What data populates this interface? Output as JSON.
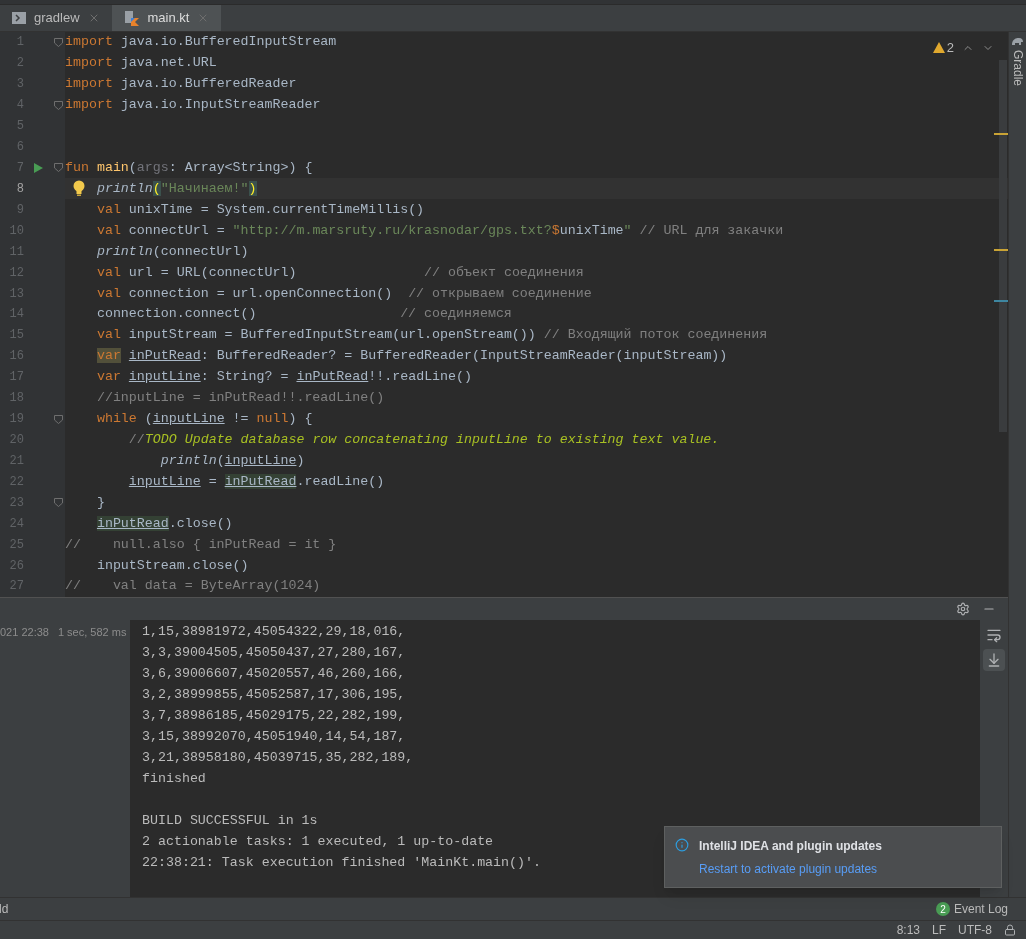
{
  "tabs": [
    {
      "label": "gradlew",
      "kind": "terminal",
      "selected": false
    },
    {
      "label": "main.kt",
      "kind": "kotlin",
      "selected": true
    }
  ],
  "editor": {
    "warnings": "2",
    "lines": [
      {
        "number": "1",
        "fold": true,
        "current": false,
        "runnable": false,
        "hint": false,
        "tokens": [
          {
            "text": "import",
            "kind": "kw"
          },
          {
            "text": " java.io.BufferedInputStream",
            "kind": "plain"
          }
        ]
      },
      {
        "number": "2",
        "fold": false,
        "current": false,
        "runnable": false,
        "hint": false,
        "tokens": [
          {
            "text": "import",
            "kind": "kw"
          },
          {
            "text": " java.net.URL",
            "kind": "plain"
          }
        ]
      },
      {
        "number": "3",
        "fold": false,
        "current": false,
        "runnable": false,
        "hint": false,
        "tokens": [
          {
            "text": "import",
            "kind": "kw"
          },
          {
            "text": " java.io.BufferedReader",
            "kind": "plain"
          }
        ]
      },
      {
        "number": "4",
        "fold": true,
        "current": false,
        "runnable": false,
        "hint": false,
        "tokens": [
          {
            "text": "import",
            "kind": "kw"
          },
          {
            "text": " java.io.InputStreamReader",
            "kind": "plain"
          }
        ]
      },
      {
        "number": "5",
        "fold": false,
        "current": false,
        "runnable": false,
        "hint": false
      },
      {
        "number": "6",
        "fold": false,
        "current": false,
        "runnable": false,
        "hint": false
      },
      {
        "number": "7",
        "fold": true,
        "current": false,
        "runnable": true,
        "hint": false,
        "tokens": [
          {
            "text": "fun ",
            "kind": "kw"
          },
          {
            "text": "main",
            "kind": "fn"
          },
          {
            "text": "(",
            "kind": "plain"
          },
          {
            "text": "args",
            "kind": "param"
          },
          {
            "text": ": Array<String>) {",
            "kind": "plain"
          }
        ]
      },
      {
        "number": "8",
        "fold": false,
        "current": true,
        "runnable": false,
        "hint": true,
        "tokens": [
          {
            "text": "    println",
            "kind": "call"
          },
          {
            "text": "(",
            "kind": "brace"
          },
          {
            "text": "\"Начинаем!\"",
            "kind": "str"
          },
          {
            "text": ")",
            "kind": "brace"
          }
        ]
      },
      {
        "number": "9",
        "fold": false,
        "current": false,
        "runnable": false,
        "hint": false,
        "tokens": [
          {
            "text": "    val",
            "kind": "kw"
          },
          {
            "text": " unixTime = System.currentTimeMillis()",
            "kind": "plain"
          }
        ]
      },
      {
        "number": "10",
        "fold": false,
        "current": false,
        "runnable": false,
        "hint": false,
        "tokens": [
          {
            "text": "    val",
            "kind": "kw"
          },
          {
            "text": " connectUrl = ",
            "kind": "plain"
          },
          {
            "text": "\"http://m.marsruty.ru/krasnodar/gps.txt?",
            "kind": "str"
          },
          {
            "text": "$",
            "kind": "kw"
          },
          {
            "text": "unixTime",
            "kind": "plain"
          },
          {
            "text": "\"",
            "kind": "str"
          },
          {
            "text": " // URL для закачки",
            "kind": "cmt"
          }
        ]
      },
      {
        "number": "11",
        "fold": false,
        "current": false,
        "runnable": false,
        "hint": false,
        "tokens": [
          {
            "text": "    println",
            "kind": "call"
          },
          {
            "text": "(connectUrl)",
            "kind": "plain"
          }
        ]
      },
      {
        "number": "12",
        "fold": false,
        "current": false,
        "runnable": false,
        "hint": false,
        "tokens": [
          {
            "text": "    val",
            "kind": "kw"
          },
          {
            "text": " url = URL(connectUrl)                ",
            "kind": "plain"
          },
          {
            "text": "// объект соединения",
            "kind": "cmt"
          }
        ]
      },
      {
        "number": "13",
        "fold": false,
        "current": false,
        "runnable": false,
        "hint": false,
        "tokens": [
          {
            "text": "    val",
            "kind": "kw"
          },
          {
            "text": " connection = url.openConnection()  ",
            "kind": "plain"
          },
          {
            "text": "// открываем соединение",
            "kind": "cmt"
          }
        ]
      },
      {
        "number": "14",
        "fold": false,
        "current": false,
        "runnable": false,
        "hint": false,
        "tokens": [
          {
            "text": "    connection.connect()                  ",
            "kind": "plain"
          },
          {
            "text": "// соединяемся",
            "kind": "cmt"
          }
        ]
      },
      {
        "number": "15",
        "fold": false,
        "current": false,
        "runnable": false,
        "hint": false,
        "tokens": [
          {
            "text": "    val",
            "kind": "kw"
          },
          {
            "text": " inputStream = BufferedInputStream(url.openStream()) ",
            "kind": "plain"
          },
          {
            "text": "// Входящий поток соединения",
            "kind": "cmt"
          }
        ]
      },
      {
        "number": "16",
        "fold": false,
        "current": false,
        "runnable": false,
        "hint": false,
        "tokens": [
          {
            "text": "    var",
            "kind": "kw-hl"
          },
          {
            "text": " inPutRead",
            "kind": "ul"
          },
          {
            "text": ": BufferedReader? = BufferedReader(InputStreamReader(inputStream))",
            "kind": "plain"
          }
        ]
      },
      {
        "number": "17",
        "fold": false,
        "current": false,
        "runnable": false,
        "hint": false,
        "tokens": [
          {
            "text": "    var",
            "kind": "kw"
          },
          {
            "text": " inputLine",
            "kind": "ul"
          },
          {
            "text": ": String? = ",
            "kind": "plain"
          },
          {
            "text": "inPutRead",
            "kind": "ul"
          },
          {
            "text": "!!.readLine()",
            "kind": "plain"
          }
        ]
      },
      {
        "number": "18",
        "fold": false,
        "current": false,
        "runnable": false,
        "hint": false,
        "tokens": [
          {
            "text": "    //inputLine = inPutRead!!.readLine()",
            "kind": "cmt"
          }
        ]
      },
      {
        "number": "19",
        "fold": true,
        "current": false,
        "runnable": false,
        "hint": false,
        "tokens": [
          {
            "text": "    while",
            "kind": "kw"
          },
          {
            "text": " (",
            "kind": "plain"
          },
          {
            "text": "inputLine",
            "kind": "ul"
          },
          {
            "text": " != ",
            "kind": "plain"
          },
          {
            "text": "null",
            "kind": "kw"
          },
          {
            "text": ") {",
            "kind": "plain"
          }
        ]
      },
      {
        "number": "20",
        "fold": false,
        "current": false,
        "runnable": false,
        "hint": false,
        "tokens": [
          {
            "text": "        //",
            "kind": "cmt"
          },
          {
            "text": "TODO Update database row concatenating inputLine to existing text value.",
            "kind": "todo"
          }
        ]
      },
      {
        "number": "21",
        "fold": false,
        "current": false,
        "runnable": false,
        "hint": false,
        "tokens": [
          {
            "text": "            println",
            "kind": "call"
          },
          {
            "text": "(",
            "kind": "plain"
          },
          {
            "text": "inputLine",
            "kind": "ul"
          },
          {
            "text": ")",
            "kind": "plain"
          }
        ]
      },
      {
        "number": "22",
        "fold": false,
        "current": false,
        "runnable": false,
        "hint": false,
        "tokens": [
          {
            "text": "        inputLine",
            "kind": "ul"
          },
          {
            "text": " = ",
            "kind": "plain"
          },
          {
            "text": "inPutRead",
            "kind": "ul-hl"
          },
          {
            "text": ".readLine()",
            "kind": "plain"
          }
        ]
      },
      {
        "number": "23",
        "fold": true,
        "current": false,
        "runnable": false,
        "hint": false,
        "tokens": [
          {
            "text": "    }",
            "kind": "plain"
          }
        ]
      },
      {
        "number": "24",
        "fold": false,
        "current": false,
        "runnable": false,
        "hint": false,
        "tokens": [
          {
            "text": "    inPutRead",
            "kind": "ul-hl"
          },
          {
            "text": ".close()",
            "kind": "plain"
          }
        ]
      },
      {
        "number": "25",
        "fold": false,
        "current": false,
        "runnable": false,
        "hint": false,
        "tokens": [
          {
            "text": "//    null.also { inPutRead = it }",
            "kind": "cmt"
          }
        ]
      },
      {
        "number": "26",
        "fold": false,
        "current": false,
        "runnable": false,
        "hint": false,
        "tokens": [
          {
            "text": "    inputStream.close()",
            "kind": "plain"
          }
        ]
      },
      {
        "number": "27",
        "fold": false,
        "current": false,
        "runnable": false,
        "hint": false,
        "tokens": [
          {
            "text": "//    val data = ByteArray(1024)",
            "kind": "cmt"
          }
        ]
      }
    ]
  },
  "gradle_strip": {
    "label": "Gradle"
  },
  "run": {
    "time": "021 22:38",
    "duration": "1 sec, 582 ms",
    "output": [
      "1,15,38981972,45054322,29,18,016,",
      "3,3,39004505,45050437,27,280,167,",
      "3,6,39006607,45020557,46,260,166,",
      "3,2,38999855,45052587,17,306,195,",
      "3,7,38986185,45029175,22,282,199,",
      "3,15,38992070,45051940,14,54,187,",
      "3,21,38958180,45039715,35,282,189,",
      "finished"
    ],
    "result": [
      "BUILD SUCCESSFUL in 1s",
      "2 actionable tasks: 1 executed, 1 up-to-date",
      "22:38:21: Task execution finished 'MainKt.main()'."
    ],
    "tools": [
      {
        "kind": "soft-wrap",
        "selected": false
      },
      {
        "kind": "scroll-to-end",
        "selected": true
      }
    ]
  },
  "notification": {
    "title": "IntelliJ IDEA and plugin updates",
    "link": "Restart to activate plugin updates"
  },
  "tool_bar": {
    "left": "ld",
    "event_log": {
      "label": "Event Log",
      "count": "2"
    }
  },
  "status_bar": {
    "items": [
      "8:13",
      "LF",
      "UTF-8"
    ]
  }
}
